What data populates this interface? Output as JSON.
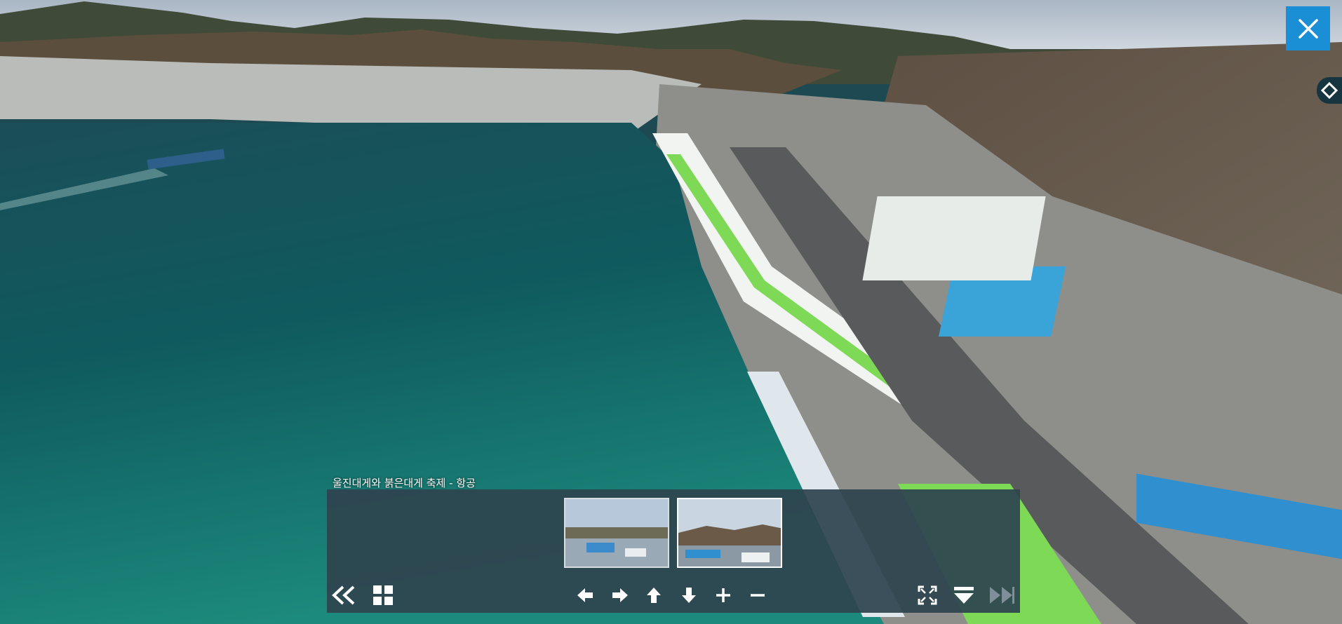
{
  "viewer": {
    "scene_name": "aerial-harbor-panorama",
    "caption": "울진대게와 붉은대게 축제 - 항공"
  },
  "close_icon": "close-icon",
  "side_marker_icon": "diamond-marker-icon",
  "thumbnails": [
    {
      "name": "thumbnail-1",
      "active": false
    },
    {
      "name": "thumbnail-2",
      "active": true
    }
  ],
  "toolbar": {
    "left": [
      "rewind-icon",
      "grid-icon"
    ],
    "center": [
      "arrow-left-icon",
      "arrow-right-icon",
      "arrow-up-icon",
      "arrow-down-icon",
      "zoom-in-icon",
      "zoom-out-icon"
    ],
    "right": [
      "fullscreen-icon",
      "hide-panel-icon",
      "fast-forward-icon"
    ]
  },
  "colors": {
    "accent": "#1a8fd6",
    "panel": "#2e444f",
    "sea": "#0f5a5e",
    "roof_green": "#7ed957",
    "roof_blue": "#3aa3d8"
  }
}
